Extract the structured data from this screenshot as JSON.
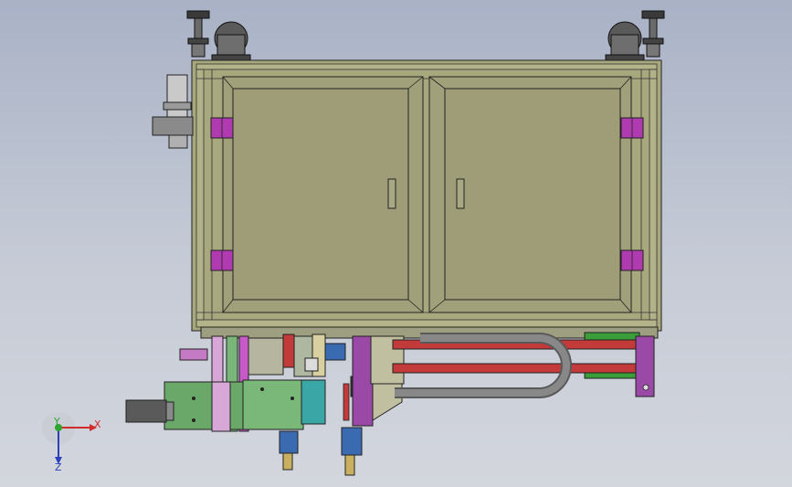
{
  "view": {
    "title": "",
    "background_colors": [
      "#a9b2c6",
      "#d3d6dd"
    ]
  },
  "model": {
    "description_colors": {
      "frame": "#a8a87e",
      "door_panel": "#9e9d78",
      "outline": "#222222",
      "hinge": "#b03ab0",
      "rail_red": "#c23a3a",
      "rail_green": "#3a9e3a",
      "purple_bracket": "#9a4aa6",
      "teal_block": "#3aa6a6",
      "green_plate": "#6aa86a",
      "gray_cable": "#6b6b6b",
      "cylinder_blue": "#3a6ab0"
    }
  },
  "triad": {
    "x_label": "X",
    "y_label": "Y",
    "z_label": "Z",
    "x_color": "#d22b2b",
    "y_color": "#2ea52e",
    "z_color": "#2b3fb8"
  }
}
